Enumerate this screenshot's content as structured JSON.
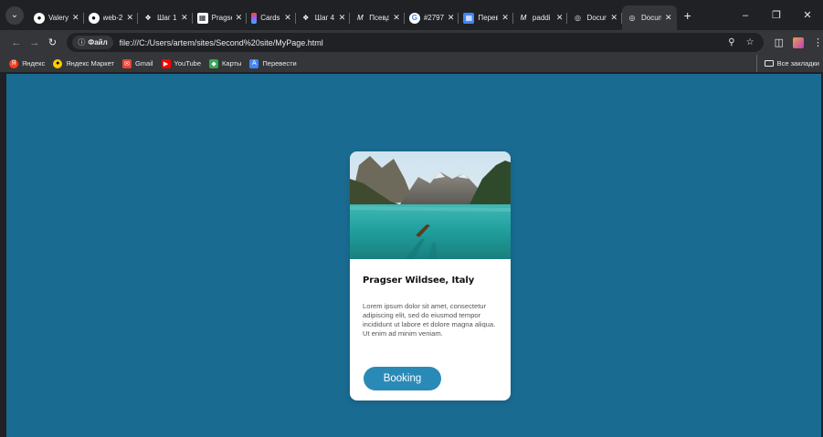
{
  "tabstrip": {
    "tabs": [
      {
        "title": "Valery",
        "favicon": "github-icon",
        "active": false
      },
      {
        "title": "web-2",
        "favicon": "github-icon",
        "active": false
      },
      {
        "title": "Шаг 1",
        "favicon": "hexlet-icon",
        "active": false
      },
      {
        "title": "Pragse",
        "favicon": "photo-icon",
        "active": false
      },
      {
        "title": "Cards",
        "favicon": "figma-icon",
        "active": false
      },
      {
        "title": "Шаг 4",
        "favicon": "hexlet-icon",
        "active": false
      },
      {
        "title": "Псевд",
        "favicon": "mdn-icon",
        "active": false
      },
      {
        "title": "#2797",
        "favicon": "google-icon",
        "active": false
      },
      {
        "title": "Перев",
        "favicon": "translate-icon",
        "active": false
      },
      {
        "title": "paddi",
        "favicon": "mdn-icon",
        "active": false
      },
      {
        "title": "Docum",
        "favicon": "globe-icon",
        "active": false
      },
      {
        "title": "Docum",
        "favicon": "globe-icon",
        "active": true
      }
    ],
    "new_tab": "+"
  },
  "toolbar": {
    "site_chip": "Файл",
    "url": "file:///C:/Users/artem/sites/Second%20site/MyPage.html"
  },
  "bookmarks": {
    "items": [
      {
        "label": "Яндекс",
        "icon": "yandex-icon",
        "color": "#fc3f1d"
      },
      {
        "label": "Яндекс Маркет",
        "icon": "yandex-market-icon",
        "color": "#ffcc00"
      },
      {
        "label": "Gmail",
        "icon": "gmail-icon",
        "color": "#ea4335"
      },
      {
        "label": "YouTube",
        "icon": "youtube-icon",
        "color": "#ff0000"
      },
      {
        "label": "Карты",
        "icon": "maps-icon",
        "color": "#34a853"
      },
      {
        "label": "Перевести",
        "icon": "translate-icon",
        "color": "#4285f4"
      }
    ],
    "all_bookmarks": "Все закладки"
  },
  "page": {
    "background": "#1a6b91",
    "card": {
      "title": "Pragser Wildsee, Italy",
      "text": "Lorem ipsum dolor sit amet, consectetur adipiscing elit, sed do eiusmod tempor incididunt ut labore et dolore magna aliqua. Ut enim ad minim veniam.",
      "button": "Booking",
      "button_color": "#2a8ab7"
    }
  }
}
